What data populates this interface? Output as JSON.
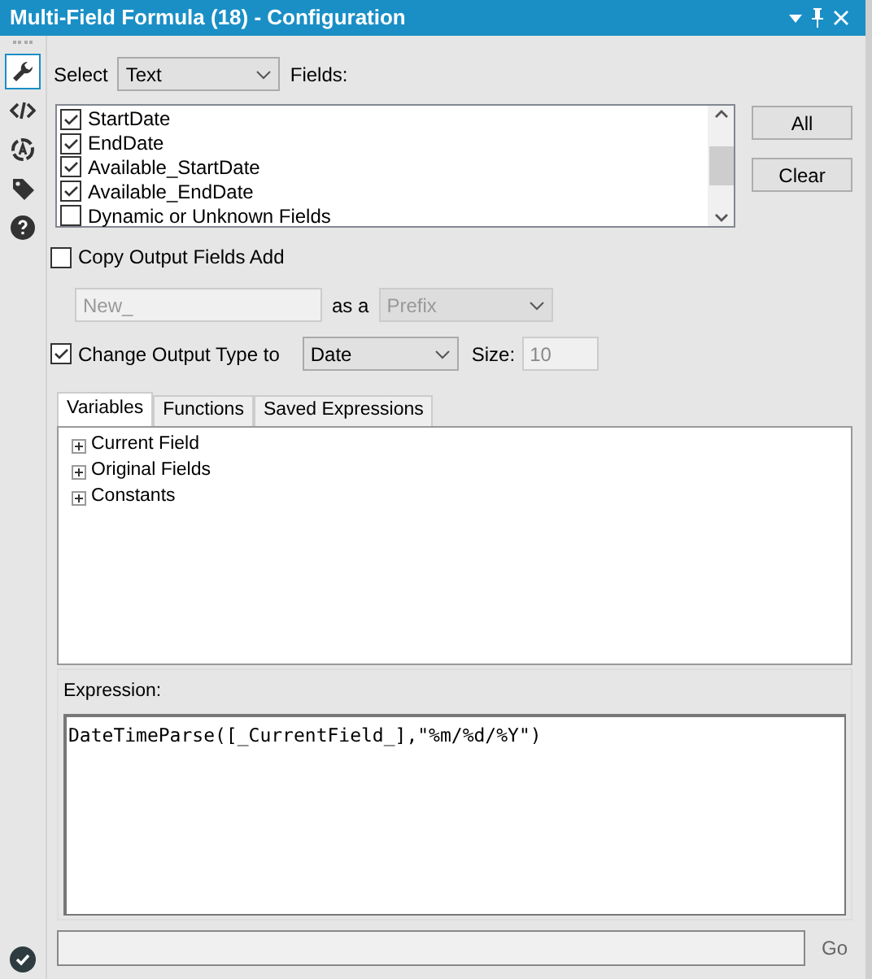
{
  "window": {
    "title": "Multi-Field Formula (18) - Configuration"
  },
  "sidebar": {
    "items": [
      {
        "kind": "wrench",
        "selected": true
      },
      {
        "kind": "code",
        "selected": false
      },
      {
        "kind": "target",
        "selected": false
      },
      {
        "kind": "tag",
        "selected": false
      },
      {
        "kind": "help",
        "selected": false
      }
    ]
  },
  "select": {
    "label": "Select",
    "value": "Text",
    "fields_label": "Fields:"
  },
  "fields": [
    {
      "name": "StartDate",
      "checked": true
    },
    {
      "name": "EndDate",
      "checked": true
    },
    {
      "name": "Available_StartDate",
      "checked": true
    },
    {
      "name": "Available_EndDate",
      "checked": true
    },
    {
      "name": "Dynamic or Unknown Fields",
      "checked": false
    }
  ],
  "buttons": [
    "All",
    "Clear"
  ],
  "copy_output": {
    "label": "Copy Output Fields Add",
    "checked": false,
    "value": "New_",
    "as_label": "as a",
    "position": "Prefix"
  },
  "change_type": {
    "label": "Change Output Type to",
    "checked": true,
    "value": "Date",
    "size_label": "Size:",
    "size": "10"
  },
  "tabs": [
    {
      "label": "Variables",
      "selected": true
    },
    {
      "label": "Functions",
      "selected": false
    },
    {
      "label": "Saved Expressions",
      "selected": false
    }
  ],
  "tree": [
    {
      "label": "Current Field",
      "expanded": false
    },
    {
      "label": "Original Fields",
      "expanded": false
    },
    {
      "label": "Constants",
      "expanded": false
    }
  ],
  "expression": {
    "label": "Expression:",
    "value": "DateTimeParse([_CurrentField_],\"%m/%d/%Y\")"
  },
  "go": {
    "label": "Go"
  }
}
